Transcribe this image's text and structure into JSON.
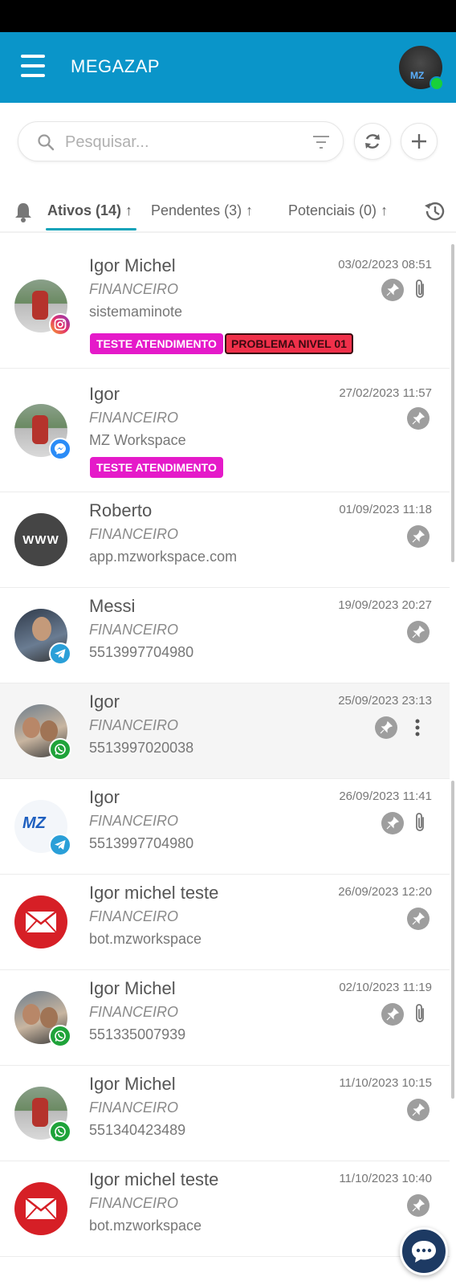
{
  "app": {
    "title": "MEGAZAP"
  },
  "search": {
    "placeholder": "Pesquisar..."
  },
  "tabs": [
    {
      "label": "Ativos (14)",
      "arrow": "↑"
    },
    {
      "label": "Pendentes (3)",
      "arrow": "↑"
    },
    {
      "label": "Potenciais (0)",
      "arrow": "↑"
    }
  ],
  "avatar_text": {
    "www": "WWW",
    "mz": "MZ",
    "user": "MZ"
  },
  "tickets": [
    {
      "name": "Igor Michel",
      "queue": "FINANCEIRO",
      "sub": "sistemaminote",
      "date": "03/02/2023 08:51",
      "channel": "instagram",
      "tags": [
        "TESTE ATENDIMENTO",
        "PROBLEMA NIVEL 01"
      ],
      "attachment": true
    },
    {
      "name": "Igor",
      "queue": "FINANCEIRO",
      "sub": "MZ Workspace",
      "date": "27/02/2023 11:57",
      "channel": "messenger",
      "tags": [
        "TESTE ATENDIMENTO"
      ],
      "attachment": false
    },
    {
      "name": "Roberto",
      "queue": "FINANCEIRO",
      "sub": "app.mzworkspace.com",
      "date": "01/09/2023 11:18",
      "channel": "web",
      "attachment": false
    },
    {
      "name": "Messi",
      "queue": "FINANCEIRO",
      "sub": "5513997704980",
      "date": "19/09/2023 20:27",
      "channel": "telegram",
      "attachment": false
    },
    {
      "name": "Igor",
      "queue": "FINANCEIRO",
      "sub": "5513997020038",
      "date": "25/09/2023 23:13",
      "channel": "whatsapp",
      "attachment": false,
      "selected": true
    },
    {
      "name": "Igor",
      "queue": "FINANCEIRO",
      "sub": "5513997704980",
      "date": "26/09/2023 11:41",
      "channel": "telegram",
      "attachment": true
    },
    {
      "name": "Igor michel teste",
      "queue": "FINANCEIRO",
      "sub": "bot.mzworkspace",
      "date": "26/09/2023 12:20",
      "channel": "email",
      "attachment": false
    },
    {
      "name": "Igor Michel",
      "queue": "FINANCEIRO",
      "sub": "551335007939",
      "date": "02/10/2023 11:19",
      "channel": "whatsapp",
      "attachment": true
    },
    {
      "name": "Igor Michel",
      "queue": "FINANCEIRO",
      "sub": "551340423489",
      "date": "11/10/2023 10:15",
      "channel": "whatsapp",
      "attachment": false
    },
    {
      "name": "Igor michel teste",
      "queue": "FINANCEIRO",
      "sub": "bot.mzworkspace",
      "date": "11/10/2023 10:40",
      "channel": "email",
      "attachment": false
    }
  ],
  "colors": {
    "appbar": "#0a95c9",
    "tab_underline": "#11a3b9",
    "tag_pink": "#e51ac9",
    "tag_red": "#f0304a",
    "online": "#18d03a"
  },
  "icons": [
    "menu-icon",
    "search-icon",
    "filter-icon",
    "refresh-icon",
    "plus-icon",
    "bell-icon",
    "history-icon",
    "pin-icon",
    "paperclip-icon",
    "kebab-icon",
    "chat-icon"
  ]
}
